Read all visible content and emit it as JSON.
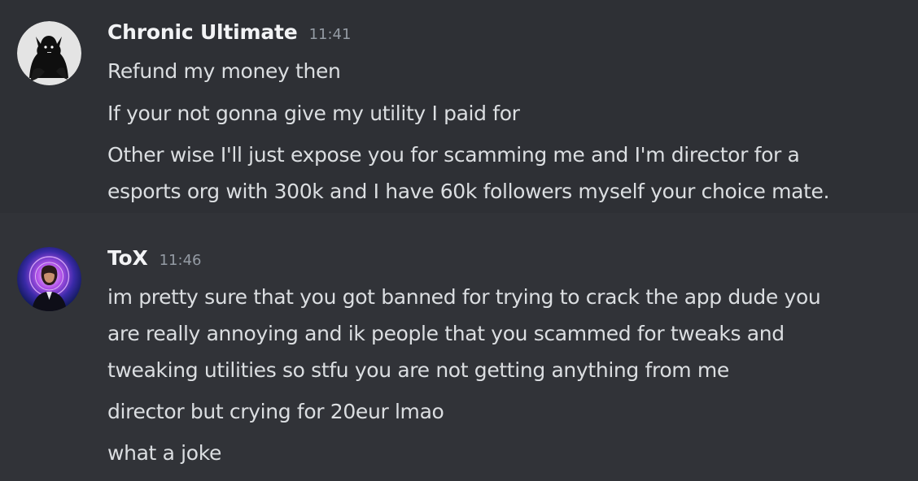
{
  "messages": [
    {
      "username": "Chronic Ultimate",
      "timestamp": "11:41",
      "lines": [
        "Refund my money then",
        "If your not gonna give my utility I paid for",
        "Other wise I'll just expose you for scamming me and I'm director for a\nesports org with 300k and I have 60k followers myself your choice mate."
      ]
    },
    {
      "username": "ToX",
      "timestamp": "11:46",
      "lines": [
        "im pretty sure that you got banned for trying to crack the app dude you\nare really annoying and ik people that you scammed for tweaks and\ntweaking utilities so stfu you are not getting anything from me",
        "director but crying for 20eur lmao",
        "what a joke"
      ]
    }
  ],
  "colors": {
    "background": "#313338",
    "highlighted_background": "#2e3035",
    "username": "#f2f3f5",
    "timestamp": "#949ba4",
    "message_text": "#dbdee1"
  },
  "avatars": [
    "demon-avatar-icon",
    "john-wick-avatar-icon"
  ]
}
